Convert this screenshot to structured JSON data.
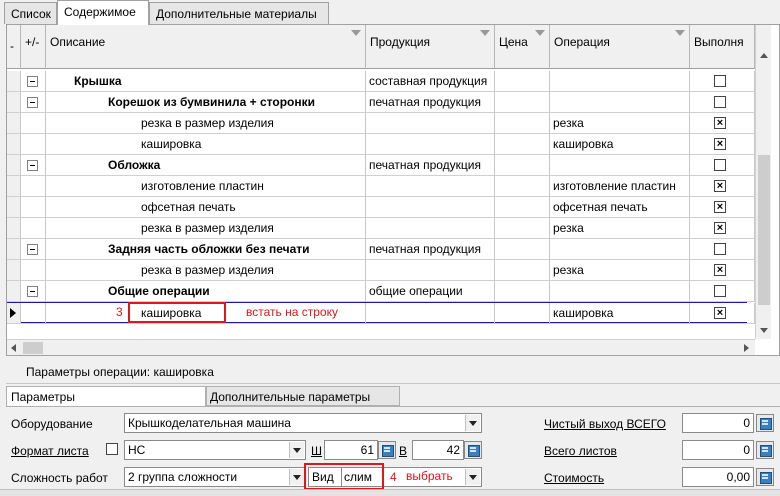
{
  "tabs": [
    "Список",
    "Содержимое",
    "Дополнительные материалы"
  ],
  "grid": {
    "columns": {
      "toggle": "+/-",
      "description": "Описание",
      "product": "Продукция",
      "price": "Цена",
      "operation": "Операция",
      "done": "Выполня"
    },
    "rows": [
      {
        "level": 1,
        "bold": true,
        "toggle": true,
        "description": "Крышка",
        "product": "составная продукция",
        "operation": "",
        "checked": false
      },
      {
        "level": 2,
        "bold": true,
        "toggle": true,
        "description": "Корешок из бумвинила + сторонки",
        "product": "печатная продукция",
        "operation": "",
        "checked": false
      },
      {
        "level": 3,
        "bold": false,
        "toggle": false,
        "description": "резка в размер изделия",
        "product": "",
        "operation": "резка",
        "checked": true
      },
      {
        "level": 3,
        "bold": false,
        "toggle": false,
        "description": "кашировка",
        "product": "",
        "operation": "кашировка",
        "checked": true
      },
      {
        "level": 2,
        "bold": true,
        "toggle": true,
        "description": "Обложка",
        "product": "печатная продукция",
        "operation": "",
        "checked": false
      },
      {
        "level": 3,
        "bold": false,
        "toggle": false,
        "description": "изготовление пластин",
        "product": "",
        "operation": "изготовление пластин",
        "checked": true
      },
      {
        "level": 3,
        "bold": false,
        "toggle": false,
        "description": "офсетная печать",
        "product": "",
        "operation": "офсетная печать",
        "checked": true
      },
      {
        "level": 3,
        "bold": false,
        "toggle": false,
        "description": "резка в размер изделия",
        "product": "",
        "operation": "резка",
        "checked": true
      },
      {
        "level": 2,
        "bold": true,
        "toggle": true,
        "description": "Задняя часть обложки без печати",
        "product": "печатная продукция",
        "operation": "",
        "checked": false
      },
      {
        "level": 3,
        "bold": false,
        "toggle": false,
        "description": "резка в размер изделия",
        "product": "",
        "operation": "резка",
        "checked": true
      },
      {
        "level": 2,
        "bold": true,
        "toggle": true,
        "description": "Общие операции",
        "product": "общие операции",
        "operation": "",
        "checked": false
      },
      {
        "level": 3,
        "bold": false,
        "toggle": false,
        "current": true,
        "description": "кашировка",
        "product": "",
        "operation": "кашировка",
        "checked": true
      }
    ]
  },
  "annotations": {
    "step3_num": "3",
    "step3_text": "встать на строку",
    "step4_num": "4",
    "step4_text": "выбрать"
  },
  "params": {
    "title": "Параметры операции: кашировка",
    "tab_main": "Параметры",
    "tab_extra": "Дополнительные параметры",
    "equipment_label": "Оборудование",
    "equipment_value": "Крышкоделательная машина",
    "sheet_format_label": "Формат листа",
    "sheet_format_value": "НС",
    "width_label": "Ш",
    "width_value": "61",
    "height_label": "В",
    "height_value": "42",
    "complexity_label": "Сложность работ",
    "complexity_value": "2 группа сложности",
    "type_label": "Вид",
    "type_value": "слим",
    "net_output_label": "Чистый выход ВСЕГО",
    "net_output_value": "0",
    "total_sheets_label": "Всего листов",
    "total_sheets_value": "0",
    "cost_label": "Стоимость",
    "cost_value": "0,00"
  },
  "colors": {
    "annotation_red": "#e0161b",
    "current_row_line": "#1a1aa8"
  }
}
